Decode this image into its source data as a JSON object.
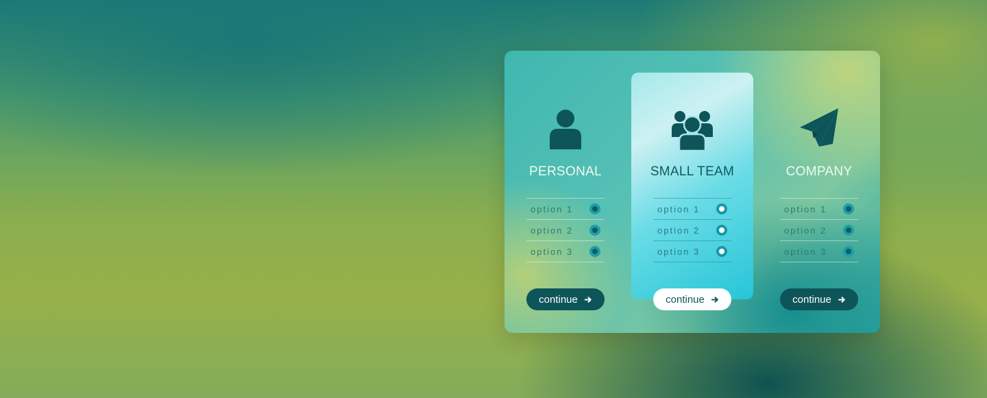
{
  "plans": [
    {
      "title": "PERSONAL",
      "icon": "person-icon",
      "options": [
        "option 1",
        "option 2",
        "option 3"
      ],
      "button_label": "continue",
      "highlighted": false
    },
    {
      "title": "SMALL TEAM",
      "icon": "group-icon",
      "options": [
        "option 1",
        "option 2",
        "option 3"
      ],
      "button_label": "continue",
      "highlighted": true
    },
    {
      "title": "COMPANY",
      "icon": "paper-plane-icon",
      "options": [
        "option 1",
        "option 2",
        "option 3"
      ],
      "button_label": "continue",
      "highlighted": false
    }
  ],
  "colors": {
    "accent_dark": "#0e5559",
    "highlight": "#6adce6",
    "button_light": "#ffffff"
  }
}
